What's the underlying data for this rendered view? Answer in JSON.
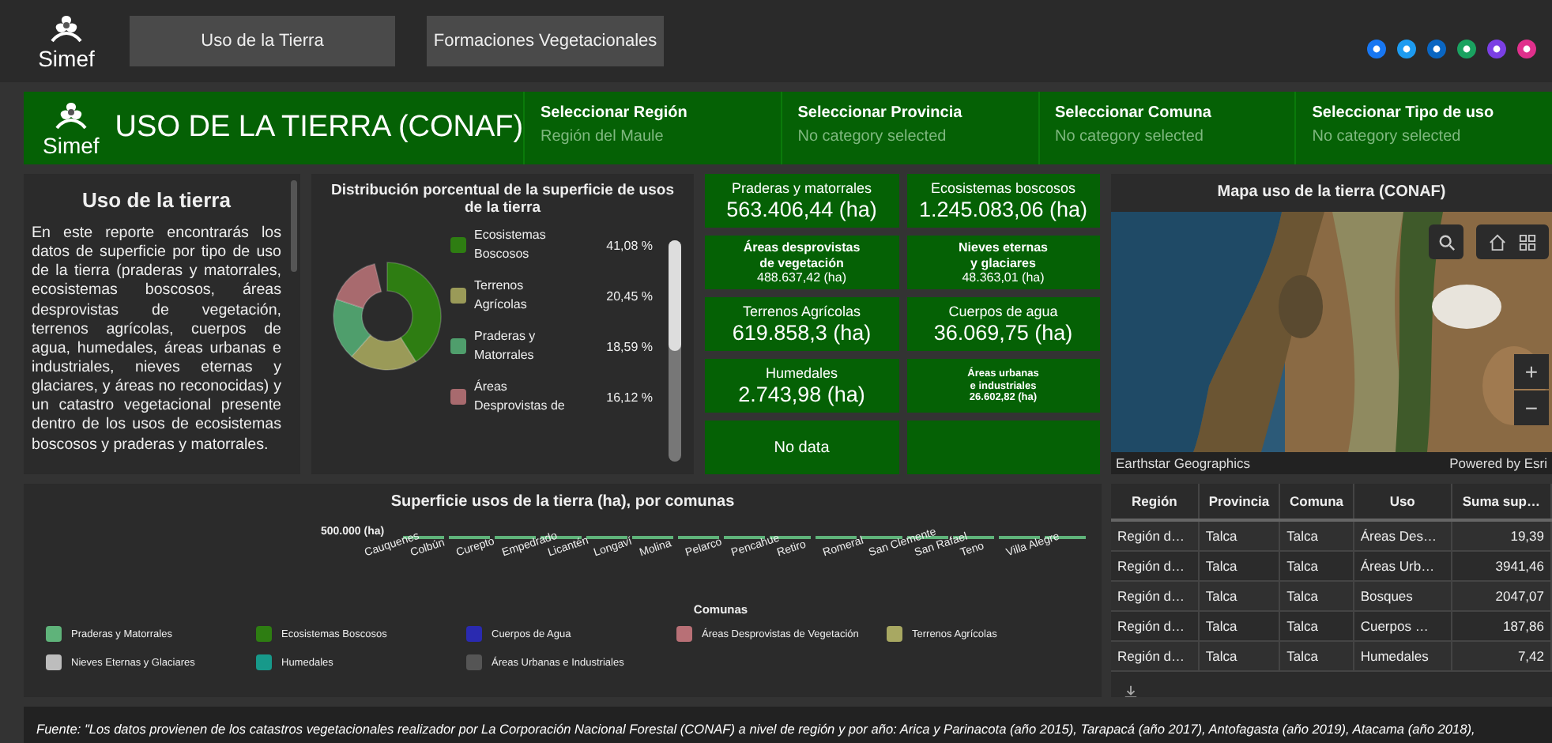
{
  "header": {
    "logo_text": "Simef",
    "tabs": [
      {
        "label": "Uso de la Tierra"
      },
      {
        "label": "Formaciones Vegetacionales"
      }
    ],
    "share_icons": [
      {
        "color": "#1877f2"
      },
      {
        "color": "#1d9bf0"
      },
      {
        "color": "#0a66c2"
      },
      {
        "color": "#1aa260"
      },
      {
        "color": "#7b3fe4"
      },
      {
        "color": "#e0308c"
      }
    ]
  },
  "banner": {
    "logo_text": "Simef",
    "title": "USO DE LA TIERRA (CONAF)",
    "filters": [
      {
        "label": "Seleccionar Región",
        "value": "Región del Maule"
      },
      {
        "label": "Seleccionar Provincia",
        "value": "No category selected"
      },
      {
        "label": "Seleccionar Comuna",
        "value": "No category selected"
      },
      {
        "label": "Seleccionar Tipo de uso",
        "value": "No category selected"
      }
    ]
  },
  "intro": {
    "title": "Uso de la tierra",
    "body": "En este reporte encontrarás los datos de superficie por tipo de uso de la tierra (praderas y matorrales, ecosistemas boscosos, áreas desprovistas de vegetación, terrenos agrícolas, cuerpos de agua, humedales, áreas urbanas e industriales, nieves eternas y glaciares, y áreas no reconocidas) y un catastro vegetacional presente dentro de los usos de ecosistemas boscosos y praderas y matorrales."
  },
  "distribution": {
    "chart_data": {
      "type": "donut",
      "title": "Distribución porcentual de la superficie de usos de la tierra",
      "categories": [
        "Ecosistemas Boscosos",
        "Terrenos Agrícolas",
        "Praderas y Matorrales",
        "Áreas Desprovistas de"
      ],
      "values": [
        41.08,
        20.45,
        18.59,
        16.12
      ],
      "value_labels": [
        "41,08 %",
        "20,45 %",
        "18,59 %",
        "16,12 %"
      ],
      "legend": "right"
    },
    "legend": [
      {
        "color": "#2e7d12"
      },
      {
        "color": "#9a9a58"
      },
      {
        "color": "#4f9e6c"
      },
      {
        "color": "#a86a6e"
      }
    ]
  },
  "cards": [
    {
      "kind": "large",
      "title": "Praderas y matorrales",
      "value": "563.406,44 (ha)"
    },
    {
      "kind": "large",
      "title": "Ecosistemas boscosos",
      "value": "1.245.083,06 (ha)"
    },
    {
      "kind": "compact",
      "title": "Áreas desprovistas\nde vegetación",
      "value": "488.637,42 (ha)"
    },
    {
      "kind": "compact",
      "title": "Nieves eternas\ny glaciares",
      "value": "48.363,01 (ha)"
    },
    {
      "kind": "large",
      "title": "Terrenos Agrícolas",
      "value": "619.858,3 (ha)"
    },
    {
      "kind": "large",
      "title": "Cuerpos de agua",
      "value": "36.069,75 (ha)"
    },
    {
      "kind": "large",
      "title": "Humedales",
      "value": "2.743,98 (ha)"
    },
    {
      "kind": "tiny",
      "title": "Áreas urbanas\ne industriales",
      "value": "26.602,82 (ha)"
    },
    {
      "kind": "note",
      "text": "No data"
    },
    {
      "kind": "empty"
    }
  ],
  "map": {
    "title": "Mapa uso de la tierra (CONAF)",
    "attribution": "Earthstar Geographics",
    "powered_by": "Powered by Esri",
    "zoom_in": "+",
    "zoom_out": "−"
  },
  "comunas_chart": {
    "title": "Superficie usos de la tierra (ha), por comunas",
    "tick": "500.000 (ha)",
    "xlabel": "Comunas",
    "categories": [
      "Cauquenes",
      "Colbún",
      "Curepto",
      "Empedrado",
      "Licantén",
      "Longaví",
      "Molina",
      "Pelarco",
      "Pencahue",
      "Retiro",
      "Romeral",
      "San Clemente",
      "San Rafael",
      "Teno",
      "Villa Alegre"
    ],
    "legend": [
      {
        "label": "Praderas y Matorrales",
        "color": "#5fb37a"
      },
      {
        "label": "Ecosistemas Boscosos",
        "color": "#2e7d12"
      },
      {
        "label": "Cuerpos de Agua",
        "color": "#2a2ab0"
      },
      {
        "label": "Áreas Desprovistas de Vegetación",
        "color": "#b87076"
      },
      {
        "label": "Terrenos Agrícolas",
        "color": "#a8a862"
      },
      {
        "label": "Nieves Eternas y Glaciares",
        "color": "#bdbdbd"
      },
      {
        "label": "Humedales",
        "color": "#17998a"
      },
      {
        "label": "Áreas Urbanas e Industriales",
        "color": "#555555"
      }
    ]
  },
  "table": {
    "columns": [
      "Región",
      "Provincia",
      "Comuna",
      "Uso",
      "Suma sup…"
    ],
    "rows": [
      [
        "Región d…",
        "Talca",
        "Talca",
        "Áreas Des…",
        "19,39"
      ],
      [
        "Región d…",
        "Talca",
        "Talca",
        "Áreas Urb…",
        "3941,46"
      ],
      [
        "Región d…",
        "Talca",
        "Talca",
        "Bosques",
        "2047,07"
      ],
      [
        "Región d…",
        "Talca",
        "Talca",
        "Cuerpos …",
        "187,86"
      ],
      [
        "Región d…",
        "Talca",
        "Talca",
        "Humedales",
        "7,42"
      ]
    ]
  },
  "footer": {
    "source": "Fuente: \"Los datos provienen de los catastros vegetacionales realizador por La Corporación Nacional Forestal (CONAF) a nivel de región y por año: Arica y Parinacota (año 2015), Tarapacá (año 2017), Antofagasta (año 2019), Atacama (año 2018),"
  }
}
